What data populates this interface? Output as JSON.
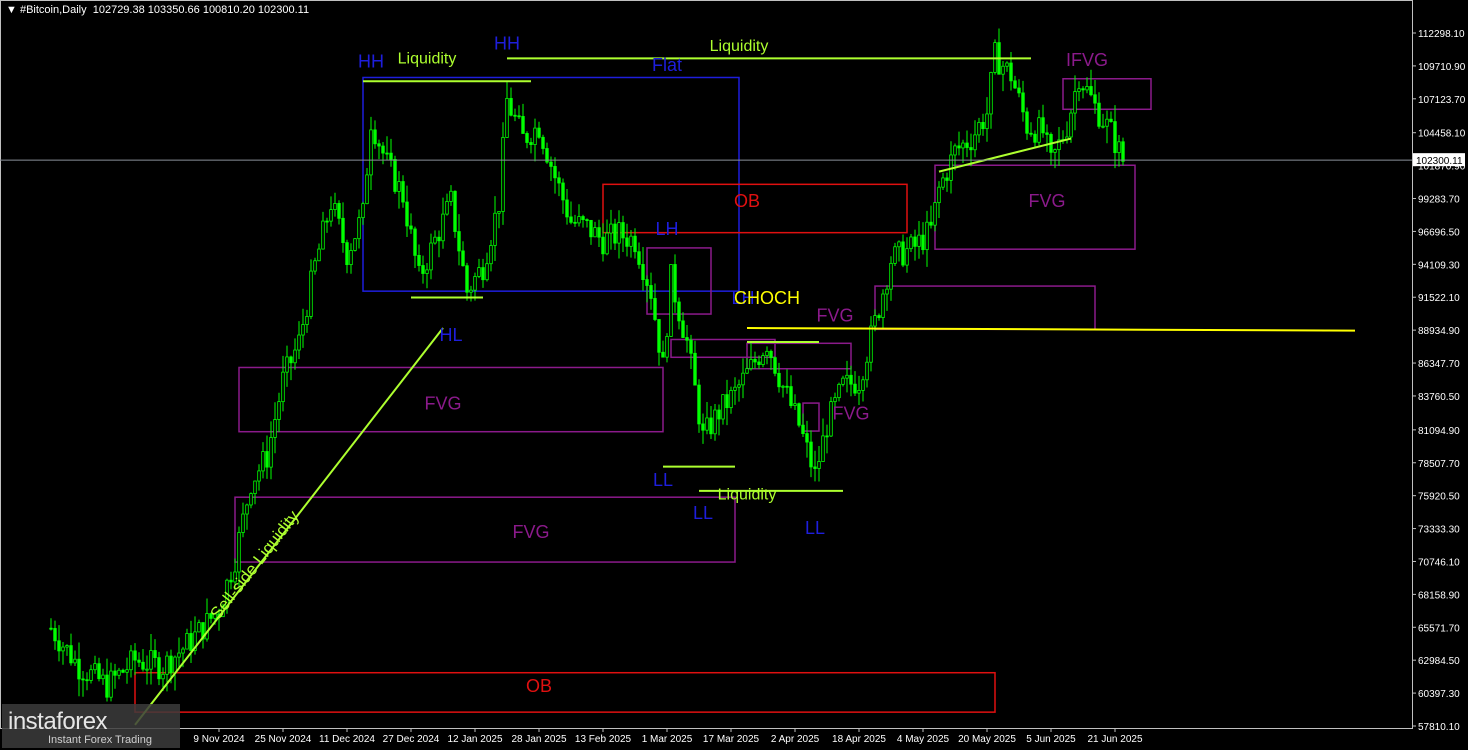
{
  "header": {
    "symbol": "#Bitcoin,Daily",
    "ohlc": "102729.38 103350.66 100810.20 102300.11"
  },
  "watermark": {
    "logo": "instaforex",
    "sub": "Instant Forex Trading"
  },
  "colors": {
    "background": "#000000",
    "candle": "#00ff00",
    "frame": "#c0c0c0",
    "blue": "#1e1edc",
    "purple": "#8b1a8b",
    "red": "#e01010",
    "lime": "#adff2f",
    "yellow": "#ffff00"
  },
  "chart_data": {
    "type": "candlestick",
    "price_axis": [
      "112298.10",
      "109710.90",
      "107123.70",
      "104458.10",
      "101870.90",
      "99283.70",
      "96696.50",
      "94109.30",
      "91522.10",
      "88934.90",
      "86347.70",
      "83760.50",
      "81094.90",
      "78507.70",
      "75920.50",
      "73333.30",
      "70746.10",
      "68158.90",
      "65571.70",
      "62984.50",
      "60397.30",
      "57810.10"
    ],
    "ylim": [
      57810.1,
      112298.1
    ],
    "current_price": "102300.11",
    "date_axis": [
      "9 Nov 2024",
      "25 Nov 2024",
      "11 Dec 2024",
      "27 Dec 2024",
      "12 Jan 2025",
      "28 Jan 2025",
      "13 Feb 2025",
      "1 Mar 2025",
      "17 Mar 2025",
      "2 Apr 2025",
      "18 Apr 2025",
      "4 May 2025",
      "20 May 2025",
      "5 Jun 2025",
      "21 Jun 2025"
    ],
    "close_path": [
      [
        "2024-09-28",
        65500
      ],
      [
        "2024-10-05",
        62500
      ],
      [
        "2024-10-12",
        61000
      ],
      [
        "2024-10-19",
        63000
      ],
      [
        "2024-10-26",
        62500
      ],
      [
        "2024-11-02",
        64500
      ],
      [
        "2024-11-09",
        67000
      ],
      [
        "2024-11-13",
        71000
      ],
      [
        "2024-11-17",
        77000
      ],
      [
        "2024-11-21",
        79000
      ],
      [
        "2024-11-25",
        85000
      ],
      [
        "2024-11-29",
        88000
      ],
      [
        "2024-12-03",
        94000
      ],
      [
        "2024-12-07",
        99000
      ],
      [
        "2024-12-11",
        95000
      ],
      [
        "2024-12-15",
        98000
      ],
      [
        "2024-12-17",
        105500
      ],
      [
        "2024-12-21",
        102000
      ],
      [
        "2024-12-25",
        99500
      ],
      [
        "2024-12-29",
        93000
      ],
      [
        "2025-01-02",
        96000
      ],
      [
        "2025-01-06",
        99000
      ],
      [
        "2025-01-10",
        92000
      ],
      [
        "2025-01-14",
        94000
      ],
      [
        "2025-01-18",
        99000
      ],
      [
        "2025-01-20",
        107000
      ],
      [
        "2025-01-24",
        104000
      ],
      [
        "2025-01-28",
        105000
      ],
      [
        "2025-02-01",
        101000
      ],
      [
        "2025-02-05",
        97500
      ],
      [
        "2025-02-09",
        97000
      ],
      [
        "2025-02-13",
        96000
      ],
      [
        "2025-02-17",
        96500
      ],
      [
        "2025-02-21",
        96000
      ],
      [
        "2025-02-25",
        92000
      ],
      [
        "2025-02-28",
        86000
      ],
      [
        "2025-03-02",
        93000
      ],
      [
        "2025-03-06",
        88000
      ],
      [
        "2025-03-10",
        80500
      ],
      [
        "2025-03-14",
        82500
      ],
      [
        "2025-03-18",
        84000
      ],
      [
        "2025-03-22",
        86000
      ],
      [
        "2025-03-26",
        88000
      ],
      [
        "2025-03-30",
        84500
      ],
      [
        "2025-04-03",
        81500
      ],
      [
        "2025-04-07",
        77500
      ],
      [
        "2025-04-10",
        81500
      ],
      [
        "2025-04-14",
        84500
      ],
      [
        "2025-04-18",
        85000
      ],
      [
        "2025-04-22",
        89500
      ],
      [
        "2025-04-26",
        94500
      ],
      [
        "2025-05-02",
        95500
      ],
      [
        "2025-05-06",
        96800
      ],
      [
        "2025-05-08",
        100000
      ],
      [
        "2025-05-12",
        103000
      ],
      [
        "2025-05-16",
        104000
      ],
      [
        "2025-05-20",
        106000
      ],
      [
        "2025-05-22",
        110500
      ],
      [
        "2025-05-26",
        109000
      ],
      [
        "2025-05-30",
        105000
      ],
      [
        "2025-06-03",
        104500
      ],
      [
        "2025-06-05",
        102000
      ],
      [
        "2025-06-09",
        105000
      ],
      [
        "2025-06-12",
        109000
      ],
      [
        "2025-06-16",
        106500
      ],
      [
        "2025-06-20",
        104500
      ],
      [
        "2025-06-23",
        102300
      ]
    ],
    "annotations": [
      {
        "text": "HH",
        "color": "blue",
        "date": "2024-12-17",
        "price": 109600
      },
      {
        "text": "HH",
        "color": "blue",
        "date": "2025-01-20",
        "price": 111000
      },
      {
        "text": "Flat",
        "color": "blue",
        "date": "2025-03-01",
        "price": 109300
      },
      {
        "text": "LH",
        "color": "blue",
        "date": "2025-03-01",
        "price": 96400
      },
      {
        "text": "HL",
        "color": "blue",
        "date": "2025-01-06",
        "price": 88100
      },
      {
        "text": "LL",
        "color": "blue",
        "date": "2025-02-28",
        "price": 76700
      },
      {
        "text": "LL",
        "color": "blue",
        "date": "2025-03-10",
        "price": 74100
      },
      {
        "text": "LH",
        "color": "blue",
        "date": "2025-03-20",
        "price": 91000
      },
      {
        "text": "LL",
        "color": "blue",
        "date": "2025-04-07",
        "price": 72900
      },
      {
        "text": "CHOCH",
        "color": "yellow",
        "date": "2025-03-26",
        "price": 91000
      },
      {
        "text": "Liquidity",
        "color": "lime",
        "date": "2024-12-31",
        "price": 109900
      },
      {
        "text": "Liquidity",
        "color": "lime",
        "date": "2025-03-19",
        "price": 110900
      },
      {
        "text": "Liquidity",
        "color": "lime",
        "date": "2025-03-21",
        "price": 75600
      },
      {
        "text": "Sell-side Liquidity",
        "color": "lime",
        "date": "2024-11-19",
        "price": 70200
      },
      {
        "text": "OB",
        "color": "red",
        "date": "2025-03-21",
        "price": 98600
      },
      {
        "text": "OB",
        "color": "red",
        "date": "2025-01-28",
        "price": 60500
      },
      {
        "text": "FVG",
        "color": "purple",
        "date": "2025-01-04",
        "price": 82700
      },
      {
        "text": "FVG",
        "color": "purple",
        "date": "2025-01-26",
        "price": 72600
      },
      {
        "text": "FVG",
        "color": "purple",
        "date": "2025-04-12",
        "price": 89600
      },
      {
        "text": "FVG",
        "color": "purple",
        "date": "2025-04-16",
        "price": 81900
      },
      {
        "text": "FVG",
        "color": "purple",
        "date": "2025-06-04",
        "price": 98600
      },
      {
        "text": "IFVG",
        "color": "purple",
        "date": "2025-06-14",
        "price": 109700
      }
    ],
    "zones": [
      {
        "label": "Flat",
        "color": "blue",
        "from": "2024-12-15",
        "to": "2025-03-19",
        "low": 92000,
        "high": 108800
      },
      {
        "label": "OB",
        "color": "red",
        "from": "2025-02-13",
        "to": "2025-04-30",
        "low": 96600,
        "high": 100400
      },
      {
        "label": "OB",
        "color": "red",
        "from": "2024-10-19",
        "to": "2025-05-22",
        "low": 58900,
        "high": 62000
      },
      {
        "label": "FVG",
        "color": "purple",
        "from": "2024-11-14",
        "to": "2025-02-28",
        "low": 80950,
        "high": 86000
      },
      {
        "label": "FVG",
        "color": "purple",
        "from": "2024-11-13",
        "to": "2025-03-18",
        "low": 70700,
        "high": 75800
      },
      {
        "label": "FVG",
        "color": "purple",
        "from": "2025-04-22",
        "to": "2025-06-16",
        "low": 89000,
        "high": 92400
      },
      {
        "label": "FVG",
        "color": "purple",
        "from": "2025-05-07",
        "to": "2025-06-26",
        "low": 95300,
        "high": 101900
      },
      {
        "label": "IFVG",
        "color": "purple",
        "from": "2025-06-08",
        "to": "2025-06-30",
        "low": 106300,
        "high": 108700
      },
      {
        "label": "",
        "color": "purple",
        "from": "2025-02-24",
        "to": "2025-03-12",
        "low": 90200,
        "high": 95400
      },
      {
        "label": "",
        "color": "purple",
        "from": "2025-03-02",
        "to": "2025-03-28",
        "low": 86800,
        "high": 88200
      },
      {
        "label": "",
        "color": "purple",
        "from": "2025-03-21",
        "to": "2025-04-16",
        "low": 85900,
        "high": 87900
      },
      {
        "label": "",
        "color": "purple",
        "from": "2025-04-04",
        "to": "2025-04-08",
        "low": 81000,
        "high": 83200
      }
    ],
    "lines": [
      {
        "color": "lime",
        "from": [
          "2024-12-15",
          108500
        ],
        "to": [
          "2025-01-26",
          108500
        ]
      },
      {
        "color": "lime",
        "from": [
          "2025-01-20",
          110300
        ],
        "to": [
          "2025-05-31",
          110300
        ]
      },
      {
        "color": "lime",
        "from": [
          "2024-12-27",
          91500
        ],
        "to": [
          "2025-01-14",
          91500
        ]
      },
      {
        "color": "lime",
        "from": [
          "2025-02-28",
          78200
        ],
        "to": [
          "2025-03-18",
          78200
        ]
      },
      {
        "color": "lime",
        "from": [
          "2025-03-09",
          76300
        ],
        "to": [
          "2025-04-14",
          76300
        ]
      },
      {
        "color": "lime",
        "from": [
          "2025-03-21",
          88000
        ],
        "to": [
          "2025-04-08",
          88000
        ]
      },
      {
        "color": "lime",
        "from": [
          "2024-10-19",
          57900
        ],
        "to": [
          "2025-01-04",
          89100
        ]
      },
      {
        "color": "lime",
        "from": [
          "2025-05-08",
          101400
        ],
        "to": [
          "2025-06-10",
          104000
        ]
      },
      {
        "color": "yellow",
        "from": [
          "2025-03-21",
          89100
        ],
        "to": [
          "2025-08-20",
          88900
        ]
      }
    ]
  }
}
